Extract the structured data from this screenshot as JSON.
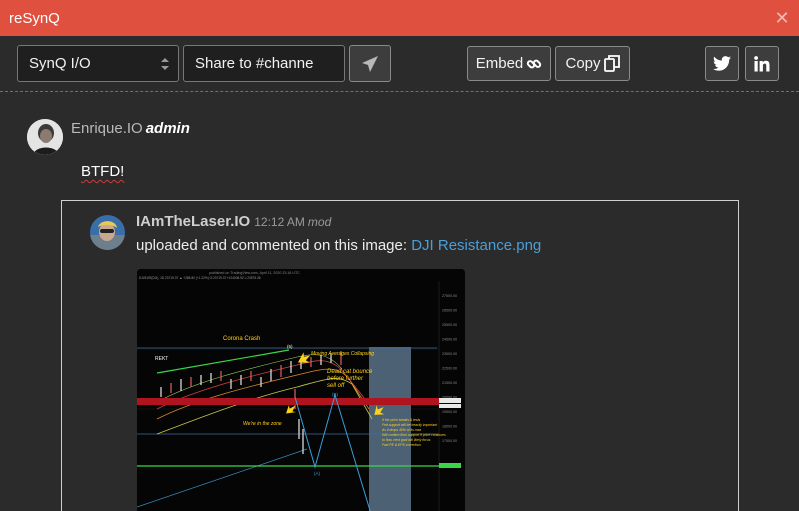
{
  "window": {
    "title": "reSynQ",
    "close_glyph": "✕"
  },
  "toolbar": {
    "channel_select": "SynQ I/O",
    "share_select": "Share to #channe",
    "send_icon": "paper-plane-icon",
    "embed_label": "Embed",
    "embed_icon": "link-icon",
    "copy_label": "Copy",
    "copy_icon": "copy-icon",
    "twitter_icon": "twitter-icon",
    "linkedin_icon": "linkedin-icon"
  },
  "message": {
    "user": "Enrique.IO",
    "role": "admin",
    "text": "BTFD!"
  },
  "embed": {
    "user": "IAmTheLaser.IO",
    "time": "12:12 AM",
    "badge": "mod",
    "text": "uploaded and commented on this image: ",
    "link": "DJI Resistance.png",
    "image": {
      "header": "published on TradingView.com, April 11, 2020 23:16 UTC",
      "ticker": "DJI/EUR(DJI), 1D 23719.37 ▲ +285.80 (+1.22%) O:23719.37 H:24008.92 L:23575.36",
      "annotations": {
        "corona": "Corona Crash",
        "wave5": "(5)",
        "rekt": "REKT",
        "moving_avg": "Moving Averages Collapsing",
        "dead_cat_1": "Dead cat bounce",
        "dead_cat_2": "before further",
        "dead_cat_3": "sell off",
        "waveB": "(B)",
        "zone": "We're in the zone",
        "waveA": "(A)",
        "note_1": "If the price breaks & tests",
        "note_2": "Fed support will be heavily important",
        "note_3": "As it drops 40% of its max",
        "note_4": "Will confirm floor support if price continues",
        "note_5": "to flow, next goal will likely focus",
        "note_6": "Fwd PE & EPS correction"
      },
      "price_tags": [
        "27500.00",
        "26500.00",
        "25500.00",
        "24500.00",
        "23500.00",
        "22500.00",
        "21500.00",
        "20500.00",
        "19500.00",
        "18500.00",
        "17500.00"
      ],
      "colors": {
        "resistance": "#b0141e",
        "support": "#3ad64a",
        "note": "#ffd21a",
        "wave": "#3aa0d8"
      }
    }
  }
}
